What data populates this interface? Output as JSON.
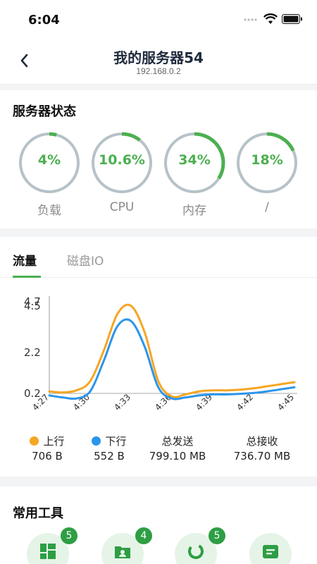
{
  "status_bar": {
    "time": "6:04"
  },
  "header": {
    "title": "我的服务器54",
    "subtitle": "192.168.0.2"
  },
  "server_status": {
    "title": "服务器状态",
    "gauges": [
      {
        "value_text": "4%",
        "fraction": 0.04,
        "label": "负载"
      },
      {
        "value_text": "10.6%",
        "fraction": 0.106,
        "label": "CPU"
      },
      {
        "value_text": "34%",
        "fraction": 0.34,
        "label": "内存"
      },
      {
        "value_text": "18%",
        "fraction": 0.18,
        "label": "/"
      }
    ]
  },
  "tabs": [
    {
      "label": "流量",
      "active": true
    },
    {
      "label": "磁盘IO",
      "active": false
    }
  ],
  "chart_data": {
    "type": "line",
    "x": [
      "4:27",
      "4:28",
      "4:29",
      "4:30",
      "4:31",
      "4:32",
      "4:33",
      "4:34",
      "4:35",
      "4:36",
      "4:37",
      "4:38",
      "4:39",
      "4:40",
      "4:41",
      "4:42",
      "4:43",
      "4:44",
      "4:45"
    ],
    "x_ticks": [
      "4:27",
      "4:30",
      "4:33",
      "4:36",
      "4:39",
      "4:42",
      "4:45"
    ],
    "y_ticks": [
      "0.2",
      "2.2",
      "4.5",
      "4.7"
    ],
    "ylim": [
      0.2,
      4.7
    ],
    "series": [
      {
        "name": "上行",
        "color": "#f5a623",
        "values": [
          0.3,
          0.25,
          0.35,
          0.8,
          2.3,
          4.1,
          4.5,
          3.2,
          0.8,
          0.05,
          0.15,
          0.3,
          0.35,
          0.35,
          0.38,
          0.45,
          0.55,
          0.65,
          0.75
        ]
      },
      {
        "name": "下行",
        "color": "#2b95ea",
        "values": [
          0.1,
          0.0,
          -0.05,
          0.3,
          1.8,
          3.5,
          3.75,
          2.5,
          0.5,
          -0.05,
          0.0,
          0.1,
          0.15,
          0.15,
          0.18,
          0.22,
          0.3,
          0.4,
          0.5
        ]
      }
    ]
  },
  "legend": {
    "up": {
      "label": "上行",
      "value": "706 B",
      "color": "#f5a623"
    },
    "down": {
      "label": "下行",
      "value": "552 B",
      "color": "#2b95ea"
    },
    "sent": {
      "label": "总发送",
      "value": "799.10 MB"
    },
    "recv": {
      "label": "总接收",
      "value": "736.70 MB"
    }
  },
  "tools": {
    "title": "常用工具",
    "items": [
      {
        "icon": "dashboard-icon",
        "badge": "5"
      },
      {
        "icon": "folder-user-icon",
        "badge": "4"
      },
      {
        "icon": "ring-progress-icon",
        "badge": "5"
      },
      {
        "icon": "document-icon",
        "badge": ""
      }
    ]
  },
  "colors": {
    "accent": "#4caf50",
    "gauge_track": "#b6c2c8",
    "badge": "#2e9e44"
  }
}
